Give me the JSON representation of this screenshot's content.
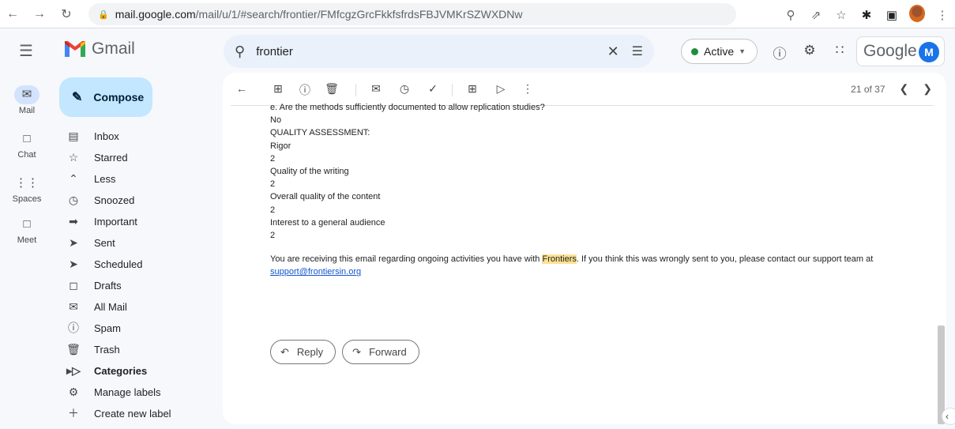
{
  "browser": {
    "url_host": "mail.google.com",
    "url_path": "/mail/u/1/#search/frontier/FMfcgzGrcFkkfsfrdsFBJVMKrSZWXDNw",
    "back_icon": "arrow-left-icon",
    "forward_icon": "arrow-right-icon",
    "reload_icon": "reload-icon"
  },
  "header": {
    "app_name": "Gmail",
    "search_value": "frontier",
    "status_label": "Active",
    "status_color": "#1e8e3e",
    "google_label": "Google",
    "avatar_initial": "M"
  },
  "rail": {
    "items": [
      {
        "label": "Mail",
        "icon": "mail-icon"
      },
      {
        "label": "Chat",
        "icon": "chat-icon"
      },
      {
        "label": "Spaces",
        "icon": "spaces-icon"
      },
      {
        "label": "Meet",
        "icon": "meet-icon"
      }
    ]
  },
  "sidebar": {
    "compose_label": "Compose",
    "items": [
      {
        "label": "Inbox",
        "icon": "inbox-icon"
      },
      {
        "label": "Starred",
        "icon": "star-icon"
      },
      {
        "label": "Less",
        "icon": "chevron-up-icon"
      },
      {
        "label": "Snoozed",
        "icon": "clock-icon"
      },
      {
        "label": "Important",
        "icon": "important-icon"
      },
      {
        "label": "Sent",
        "icon": "send-icon"
      },
      {
        "label": "Scheduled",
        "icon": "scheduled-send-icon"
      },
      {
        "label": "Drafts",
        "icon": "draft-icon"
      },
      {
        "label": "All Mail",
        "icon": "all-mail-icon"
      },
      {
        "label": "Spam",
        "icon": "spam-icon"
      },
      {
        "label": "Trash",
        "icon": "trash-icon"
      },
      {
        "label": "Categories",
        "icon": "label-icon"
      },
      {
        "label": "Manage labels",
        "icon": "gear-icon"
      },
      {
        "label": "Create new label",
        "icon": "plus-icon"
      }
    ]
  },
  "toolbar": {
    "pager_text": "21 of 37"
  },
  "email": {
    "lines": [
      "e. Are the methods sufficiently documented to allow replication studies?",
      "No",
      "QUALITY ASSESSMENT:",
      "Rigor",
      "2",
      "Quality of the writing",
      "2",
      "Overall quality of the content",
      "2",
      "Interest to a general audience",
      "2"
    ],
    "footer_before": "You are receiving this email regarding ongoing activities you have with ",
    "footer_highlight": "Frontiers",
    "footer_after": ". If you think this was wrongly sent to you, please contact our support team at",
    "support_email": "support@frontiersin.org",
    "highlight_color": "#fde293"
  },
  "actions": {
    "reply_label": "Reply",
    "forward_label": "Forward"
  }
}
